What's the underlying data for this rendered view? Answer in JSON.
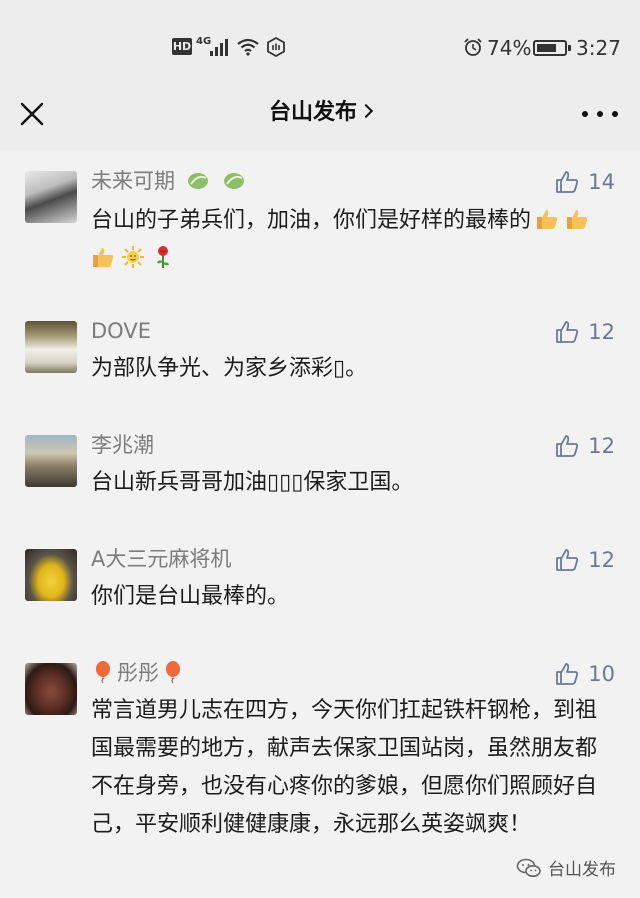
{
  "status_bar": {
    "hd": "HD",
    "network": "4G",
    "battery_percent": "74%",
    "battery_level": 0.74,
    "time": "3:27",
    "icons": [
      "hd-icon",
      "signal-icon",
      "wifi-icon",
      "shield-hex-icon",
      "alarm-icon",
      "battery-icon"
    ]
  },
  "header": {
    "title": "台山发布",
    "close_icon": "close-icon",
    "chevron_icon": "chevron-right-icon",
    "more_icon": "more-icon"
  },
  "comments": [
    {
      "name": "未来可期",
      "name_suffix": "☯ ☯",
      "likes": "14",
      "text": "台山的子弟兵们，加油，你们是好样的最棒的",
      "emojis": [
        "thumbs-up",
        "thumbs-up",
        "thumbs-up",
        "sun",
        "rose"
      ]
    },
    {
      "name": "DOVE",
      "likes": "12",
      "text": "为部队争光、为家乡添彩▯。"
    },
    {
      "name": "李兆潮",
      "likes": "12",
      "text": "台山新兵哥哥加油▯▯▯保家卫国。"
    },
    {
      "name": "A大三元麻将机",
      "likes": "12",
      "text": "你们是台山最棒的。"
    },
    {
      "name": "彤彤",
      "name_prefix_emoji": "balloon",
      "name_suffix_emoji": "balloon",
      "likes": "10",
      "text": "常言道男儿志在四方，今天你们扛起铁杆钢枪，到祖国最需要的地方，献声去保家卫国站岗，虽然朋友都不在身旁，也没有心疼你的爹娘，但愿你们照顾好自己，平安顺利健健康康，永远那么英姿飒爽！"
    }
  ],
  "watermark": {
    "label": "台山发布"
  },
  "colors": {
    "background": "#ededed",
    "comment_bg": "#f2f2f2",
    "like_blue": "#6a7a94"
  }
}
